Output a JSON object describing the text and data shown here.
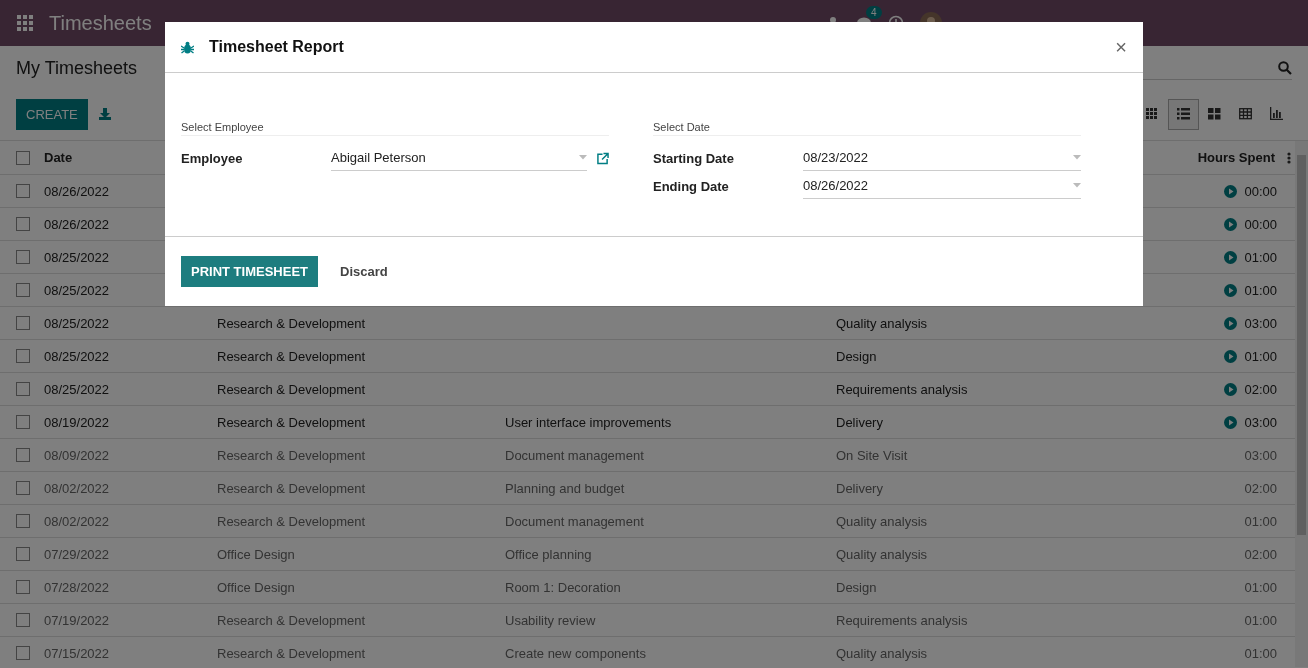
{
  "navbar": {
    "app_title": "Timesheets",
    "messages_badge": "4"
  },
  "control_panel": {
    "title": "My Timesheets",
    "create_button": "CREATE",
    "views": [
      {
        "kind": "kanban",
        "selected": false
      },
      {
        "kind": "list",
        "selected": true
      },
      {
        "kind": "grid",
        "selected": false
      },
      {
        "kind": "pivot",
        "selected": false
      },
      {
        "kind": "graph",
        "selected": false
      }
    ]
  },
  "table": {
    "all_checked": false,
    "columns": [
      {
        "label": "Date"
      },
      {
        "label": "Hours Spent"
      }
    ],
    "rows": [
      {
        "date": "08/26/2022",
        "hours": "00:00",
        "timer": true,
        "dimmed": false
      },
      {
        "date": "08/26/2022",
        "hours": "00:00",
        "timer": true,
        "dimmed": false
      },
      {
        "date": "08/25/2022",
        "hours": "01:00",
        "timer": true,
        "dimmed": false
      },
      {
        "date": "08/25/2022",
        "hours": "01:00",
        "timer": true,
        "dimmed": false
      },
      {
        "date": "08/25/2022",
        "project": "Research & Development",
        "description": "Quality analysis",
        "hours": "03:00",
        "timer": true,
        "dimmed": false
      },
      {
        "date": "08/25/2022",
        "project": "Research & Development",
        "description": "Design",
        "hours": "01:00",
        "timer": true,
        "dimmed": false
      },
      {
        "date": "08/25/2022",
        "project": "Research & Development",
        "description": "Requirements analysis",
        "hours": "02:00",
        "timer": true,
        "dimmed": false
      },
      {
        "date": "08/19/2022",
        "project": "Research & Development",
        "task": "User interface improvements",
        "description": "Delivery",
        "hours": "03:00",
        "timer": true,
        "dimmed": false
      },
      {
        "date": "08/09/2022",
        "project": "Research & Development",
        "task": "Document management",
        "description": "On Site Visit",
        "hours": "03:00",
        "timer": false,
        "dimmed": true
      },
      {
        "date": "08/02/2022",
        "project": "Research & Development",
        "task": "Planning and budget",
        "description": "Delivery",
        "hours": "02:00",
        "timer": false,
        "dimmed": true
      },
      {
        "date": "08/02/2022",
        "project": "Research & Development",
        "task": "Document management",
        "description": "Quality analysis",
        "hours": "01:00",
        "timer": false,
        "dimmed": true
      },
      {
        "date": "07/29/2022",
        "project": "Office Design",
        "task": "Office planning",
        "description": "Quality analysis",
        "hours": "02:00",
        "timer": false,
        "dimmed": true
      },
      {
        "date": "07/28/2022",
        "project": "Office Design",
        "task": "Room 1: Decoration",
        "description": "Design",
        "hours": "01:00",
        "timer": false,
        "dimmed": true
      },
      {
        "date": "07/19/2022",
        "project": "Research & Development",
        "task": "Usability review",
        "description": "Requirements analysis",
        "hours": "01:00",
        "timer": false,
        "dimmed": true
      },
      {
        "date": "07/15/2022",
        "project": "Research & Development",
        "task": "Create new components",
        "description": "Quality analysis",
        "hours": "01:00",
        "timer": false,
        "dimmed": true
      }
    ]
  },
  "dialog": {
    "title": "Timesheet Report",
    "close": "×",
    "groups": [
      {
        "heading": "Select Employee",
        "fields": [
          {
            "label": "Employee",
            "value": "Abigail Peterson",
            "external_link": true
          }
        ]
      },
      {
        "heading": "Select Date",
        "fields": [
          {
            "label": "Starting Date",
            "value": "08/23/2022"
          },
          {
            "label": "Ending Date",
            "value": "08/26/2022"
          }
        ]
      }
    ],
    "primary_button": "PRINT TIMESHEET",
    "secondary_button": "Discard"
  }
}
